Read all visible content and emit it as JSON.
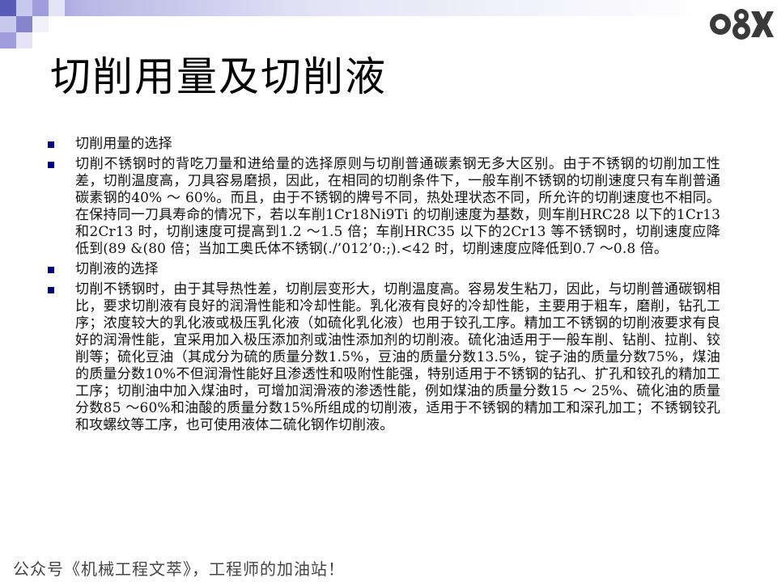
{
  "slide": {
    "title": "切削用量及切削液",
    "bullets": [
      "切削用量的选择",
      "切削不锈钢时的背吃刀量和进给量的选择原则与切削普通碳素钢无多大区别。由于不锈钢的切削加工性差，切削温度高，刀具容易磨损，因此，在相同的切削条件下，一般车削不锈钢的切削速度只有车削普通碳素钢的40% ～ 60%。而且，由于不锈钢的牌号不同，热处理状态不同，所允许的切削速度也不相同。在保持同一刀具寿命的情况下，若以车削1Cr18Ni9Ti 的切削速度为基数，则车削HRC28 以下的1Cr13 和2Cr13 时，切削速度可提高到1.2 ～1.5 倍；车削HRC35 以下的2Cr13 等不锈钢时，切削速度应降低到(89 &(80 倍；当加工奥氏体不锈钢(./’012’0:;).<42 时，切削速度应降低到0.7 ～0.8 倍。",
      "切削液的选择",
      "切削不锈钢时，由于其导热性差，切削层变形大，切削温度高。容易发生粘刀，因此，与切削普通碳钢相比，要求切削液有良好的润滑性能和冷却性能。乳化液有良好的冷却性能，主要用于粗车，磨削，钻孔工序；浓度较大的乳化液或极压乳化液（如硫化乳化液）也用于铰孔工序。精加工不锈钢的切削液要求有良好的润滑性能，宜采用加入极压添加剂或油性添加剂的切削液。硫化油适用于一般车削、钻削、拉削、铰削等；硫化豆油（其成分为硫的质量分数1.5%，豆油的质量分数13.5%，锭子油的质量分数75%，煤油的质量分数10%不但润滑性能好且渗透性和吸附性能强，特别适用于不锈钢的钻孔、扩孔和铰孔的精加工工序；切削油中加入煤油时，可增加润滑液的渗透性能，例如煤油的质量分数15 ～ 25%、硫化油的质量分数85 ～60%和油酸的质量分数15%所组成的切削液，适用于不锈钢的精加工和深孔加工；不锈钢铰孔和攻螺纹等工序，也可使用液体二硫化钢作切削液。"
    ],
    "footer": "公众号《机械工程文萃》，工程师的加油站！"
  },
  "logo": {
    "icon": "8-and-x-emblem-logo"
  },
  "colors": {
    "bullet": "#000080",
    "band_start": "#7f7fd0",
    "band_end": "#ffffff",
    "grid_dark": "#5a5ab8",
    "grid_light": "#c8c8ec"
  }
}
